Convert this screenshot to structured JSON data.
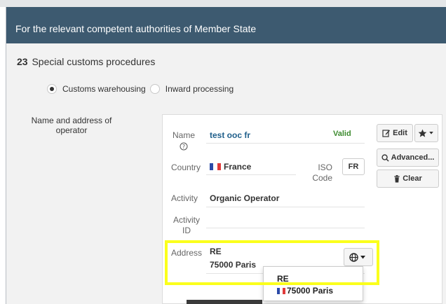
{
  "header": {
    "title": "For the relevant competent authorities of Member State"
  },
  "section": {
    "number": "23",
    "title": "Special customs procedures"
  },
  "procedures": {
    "options": [
      {
        "label": "Customs warehousing",
        "selected": true
      },
      {
        "label": "Inward processing",
        "selected": false
      }
    ]
  },
  "operator": {
    "field_label": "Name and address of operator",
    "name_label": "Name",
    "name_value": "test ooc fr",
    "name_status": "Valid",
    "country_label": "Country",
    "country_value": "France",
    "iso_label": "ISO Code",
    "iso_value": "FR",
    "activity_label": "Activity",
    "activity_value": "Organic Operator",
    "activity_id_label": "Activity ID",
    "activity_id_value": "",
    "address_label": "Address",
    "address_line1": "RE",
    "address_line2": "75000 Paris"
  },
  "buttons": {
    "edit": "Edit",
    "advanced": "Advanced...",
    "clear": "Clear"
  },
  "address_dropdown": {
    "items": [
      "RE",
      "75000 Paris"
    ]
  },
  "colors": {
    "header_bg": "#3d5a70",
    "link_blue": "#1f5f8b",
    "valid_green": "#3c8a2e",
    "highlight": "#fbff1c"
  }
}
